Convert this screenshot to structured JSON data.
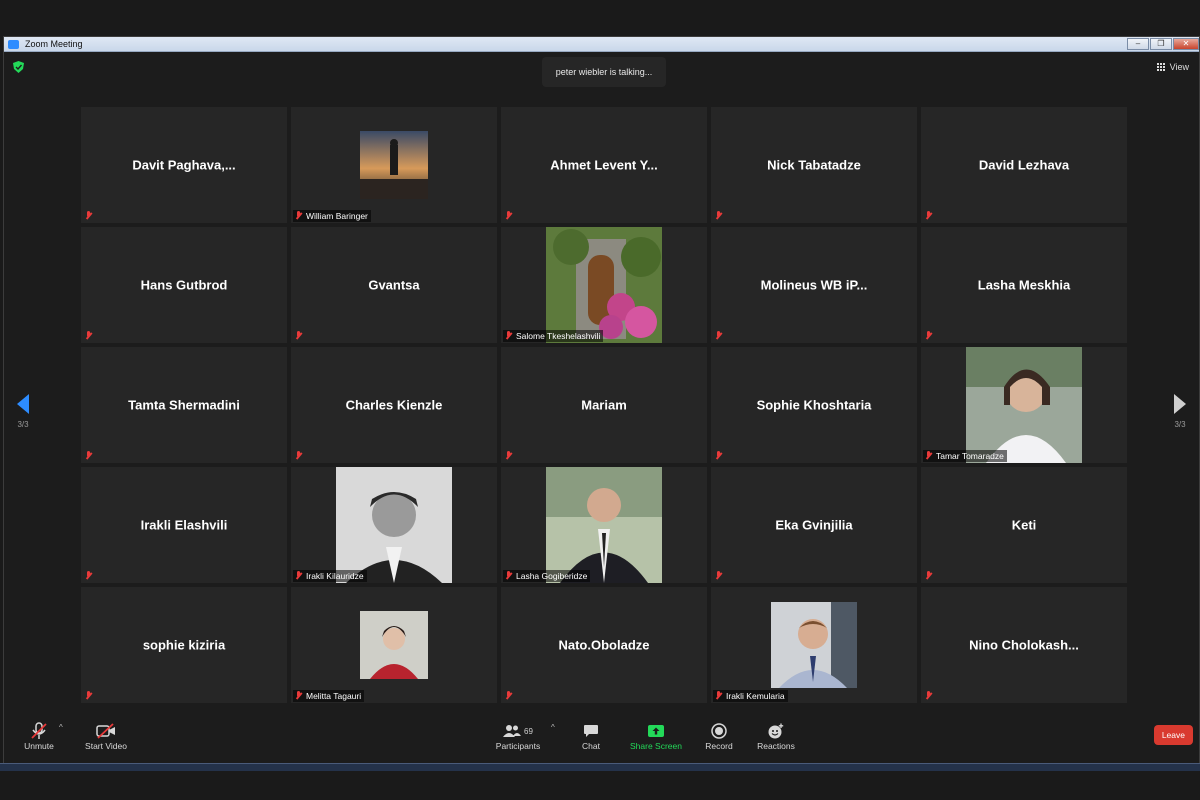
{
  "window": {
    "title": "Zoom Meeting",
    "talking": "peter wiebler  is talking...",
    "view_label": "View"
  },
  "nav": {
    "left_page": "3/3",
    "right_page": "3/3"
  },
  "participants": [
    {
      "display": "Davit  Paghava,...",
      "label": "",
      "photo": false
    },
    {
      "display": "",
      "label": "William Baringer",
      "photo": "sunset"
    },
    {
      "display": "Ahmet  Levent  Y...",
      "label": "",
      "photo": false
    },
    {
      "display": "Nick Tabatadze",
      "label": "",
      "photo": false
    },
    {
      "display": "David Lezhava",
      "label": "",
      "photo": false
    },
    {
      "display": "Hans Gutbrod",
      "label": "",
      "photo": false
    },
    {
      "display": "Gvantsa",
      "label": "",
      "photo": false
    },
    {
      "display": "",
      "label": "Salome Tkeshelashvili",
      "photo": "door"
    },
    {
      "display": "Molineus  WB  iP...",
      "label": "",
      "photo": false
    },
    {
      "display": "Lasha Meskhia",
      "label": "",
      "photo": false
    },
    {
      "display": "Tamta Shermadini",
      "label": "",
      "photo": false
    },
    {
      "display": "Charles Kienzle",
      "label": "",
      "photo": false
    },
    {
      "display": "Mariam",
      "label": "",
      "photo": false
    },
    {
      "display": "Sophie Khoshtaria",
      "label": "",
      "photo": false
    },
    {
      "display": "",
      "label": "Tamar Tomaradze",
      "photo": "woman-outdoor"
    },
    {
      "display": "Irakli Elashvili",
      "label": "",
      "photo": false
    },
    {
      "display": "",
      "label": "Irakli Kilauridze",
      "photo": "man-bw"
    },
    {
      "display": "",
      "label": "Lasha Gogiberidze",
      "photo": "man-suit"
    },
    {
      "display": "Eka Gvinjilia",
      "label": "",
      "photo": false
    },
    {
      "display": "Keti",
      "label": "",
      "photo": false
    },
    {
      "display": "sophie kiziria",
      "label": "",
      "photo": false
    },
    {
      "display": "",
      "label": "Melitta Tagauri",
      "photo": "woman-red"
    },
    {
      "display": "Nato.Oboladze",
      "label": "",
      "photo": false
    },
    {
      "display": "",
      "label": "Irakli Kemularia",
      "photo": "man-shirt"
    },
    {
      "display": "Nino  Cholokash...",
      "label": "",
      "photo": false
    }
  ],
  "toolbar": {
    "unmute": "Unmute",
    "start_video": "Start Video",
    "participants": "Participants",
    "participants_count": "69",
    "chat": "Chat",
    "share_screen": "Share Screen",
    "record": "Record",
    "reactions": "Reactions",
    "leave": "Leave"
  },
  "colors": {
    "accent": "#2d8cff",
    "share_green": "#23d959",
    "leave_red": "#d93a2f",
    "muted_red": "#e83a3a"
  }
}
